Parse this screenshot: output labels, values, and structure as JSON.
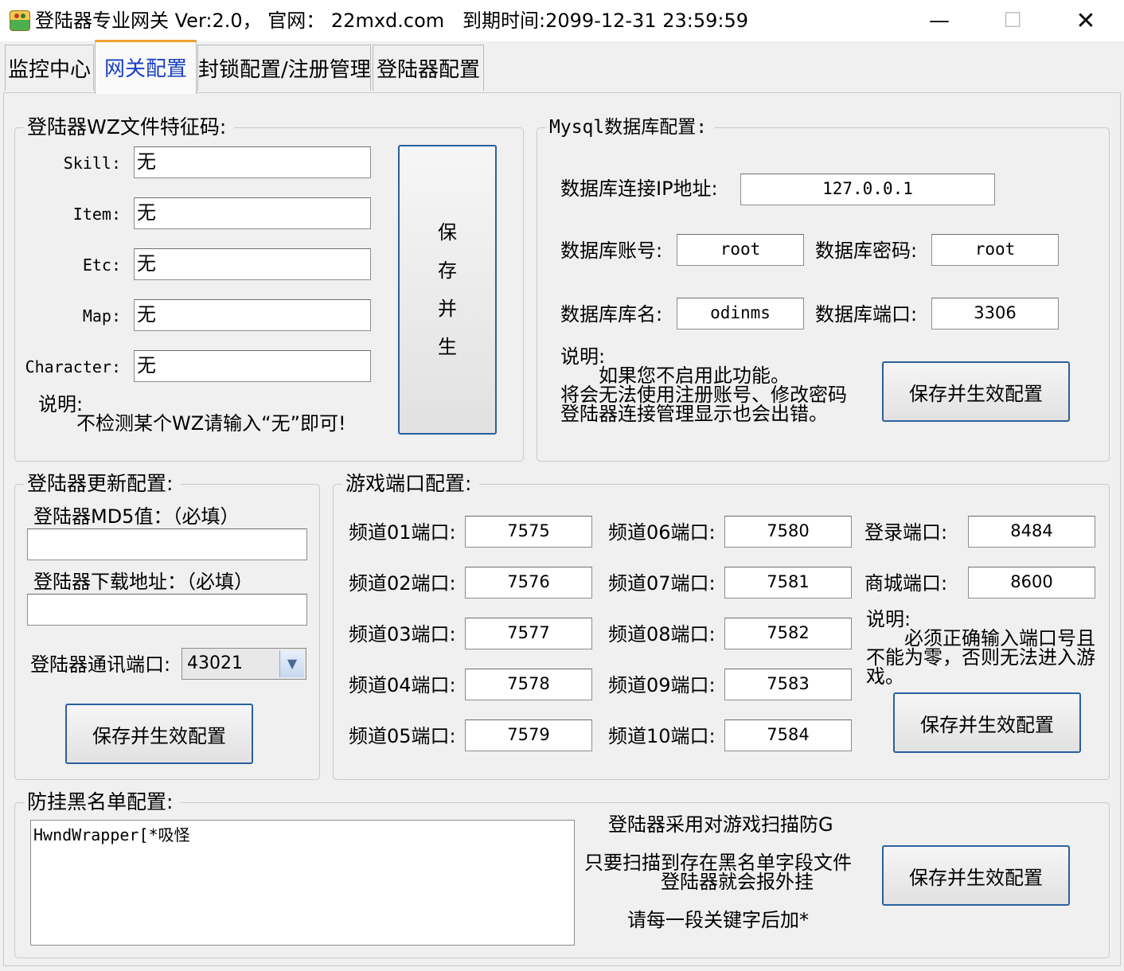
{
  "window": {
    "title": "登陆器专业网关 Ver:2.0， 官网： 22mxd.com   到期时间:2099-12-31 23:59:59",
    "minimize": "—",
    "maximize": "☐",
    "close": "✕"
  },
  "tabs": [
    {
      "label": "监控中心"
    },
    {
      "label": "网关配置"
    },
    {
      "label": "封锁配置/注册管理"
    },
    {
      "label": "登陆器配置"
    }
  ],
  "wz": {
    "title": "登陆器WZ文件特征码:",
    "fields": [
      {
        "label": "Skill:",
        "value": "无"
      },
      {
        "label": "Item:",
        "value": "无"
      },
      {
        "label": "Etc:",
        "value": "无"
      },
      {
        "label": "Map:",
        "value": "无"
      },
      {
        "label": "Character:",
        "value": "无"
      }
    ],
    "save_chars": [
      "保",
      "存",
      "并",
      "生"
    ],
    "note_title": "说明:",
    "note_text": "不检测某个WZ请输入“无”即可!"
  },
  "mysql": {
    "title": "Mysql数据库配置:",
    "ip_label": "数据库连接IP地址:",
    "ip_value": "127.0.0.1",
    "account_label": "数据库账号:",
    "account_value": "root",
    "password_label": "数据库密码:",
    "password_value": "root",
    "dbname_label": "数据库库名:",
    "dbname_value": "odinms",
    "port_label": "数据库端口:",
    "port_value": "3306",
    "note_title": "说明:",
    "note_line1": "如果您不启用此功能。",
    "note_line2": "将会无法使用注册账号、修改密码",
    "note_line3": "登陆器连接管理显示也会出错。",
    "save_label": "保存并生效配置"
  },
  "update": {
    "title": "登陆器更新配置:",
    "md5_label": "登陆器MD5值：（必填）",
    "md5_value": "",
    "url_label": "登陆器下载地址：（必填）",
    "url_value": "",
    "port_label": "登陆器通讯端口:",
    "port_value": "43021",
    "save_label": "保存并生效配置"
  },
  "ports": {
    "title": "游戏端口配置:",
    "channels_a": [
      {
        "label": "频道01端口:",
        "value": "7575"
      },
      {
        "label": "频道02端口:",
        "value": "7576"
      },
      {
        "label": "频道03端口:",
        "value": "7577"
      },
      {
        "label": "频道04端口:",
        "value": "7578"
      },
      {
        "label": "频道05端口:",
        "value": "7579"
      }
    ],
    "channels_b": [
      {
        "label": "频道06端口:",
        "value": "7580"
      },
      {
        "label": "频道07端口:",
        "value": "7581"
      },
      {
        "label": "频道08端口:",
        "value": "7582"
      },
      {
        "label": "频道09端口:",
        "value": "7583"
      },
      {
        "label": "频道10端口:",
        "value": "7584"
      }
    ],
    "login_label": "登录端口:",
    "login_value": "8484",
    "shop_label": "商城端口:",
    "shop_value": "8600",
    "note_title": "说明:",
    "note_line1": "必须正确输入端口号且",
    "note_line2": "不能为零，否则无法进入游",
    "note_line3": "戏。",
    "save_label": "保存并生效配置"
  },
  "blacklist": {
    "title": "防挂黑名单配置:",
    "content": "HwndWrapper[*吸怪",
    "info1": "登陆器采用对游戏扫描防G",
    "info2": "只要扫描到存在黑名单字段文件",
    "info3": "登陆器就会报外挂",
    "info4": "请每一段关键字后加*",
    "save_label": "保存并生效配置"
  }
}
